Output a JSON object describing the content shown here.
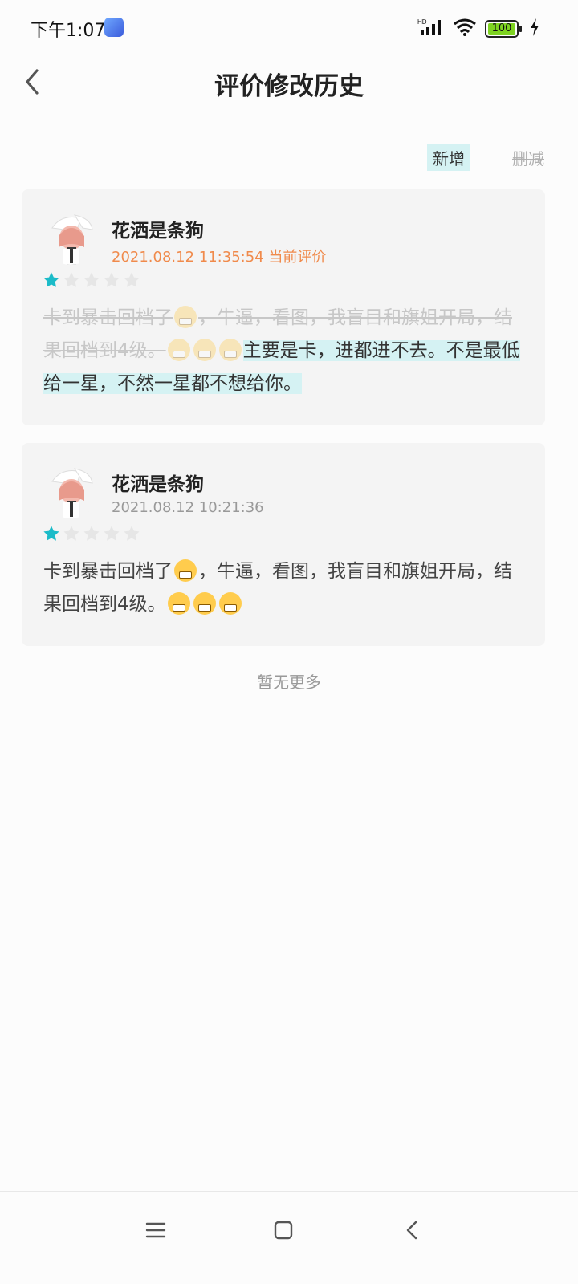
{
  "status_bar": {
    "time": "下午1:07",
    "network": "HD",
    "battery": "100"
  },
  "header": {
    "title": "评价修改历史"
  },
  "legend": {
    "added_label": "新增",
    "deleted_label": "删减"
  },
  "reviews": [
    {
      "username": "花洒是条狗",
      "datetime": "2021.08.12 11:35:54",
      "current_label": "当前评价",
      "rating": 1,
      "deleted_text_1": "卡到暴击回档了",
      "deleted_text_2": "，牛逼，看图，我盲目和旗姐开局，结果回档到4级。",
      "added_text": "主要是卡，进都进不去。不是最低给一星，不然一星都不想给你。"
    },
    {
      "username": "花洒是条狗",
      "datetime": "2021.08.12 10:21:36",
      "rating": 1,
      "text_1": "卡到暴击回档了",
      "text_2": "，牛逼，看图，我盲目和旗姐开局，结果回档到4级。"
    }
  ],
  "footer": {
    "no_more": "暂无更多"
  },
  "icons": {
    "back": "chevron-left-icon",
    "star": "star-icon",
    "emoji": "grinning-face-icon",
    "nav_menu": "menu-icon",
    "nav_home": "home-square-icon",
    "nav_back": "back-triangle-icon"
  },
  "colors": {
    "accent_teal": "#1bbbc8",
    "highlight_added": "#d5f2f3",
    "current_label": "#f08a4b"
  }
}
